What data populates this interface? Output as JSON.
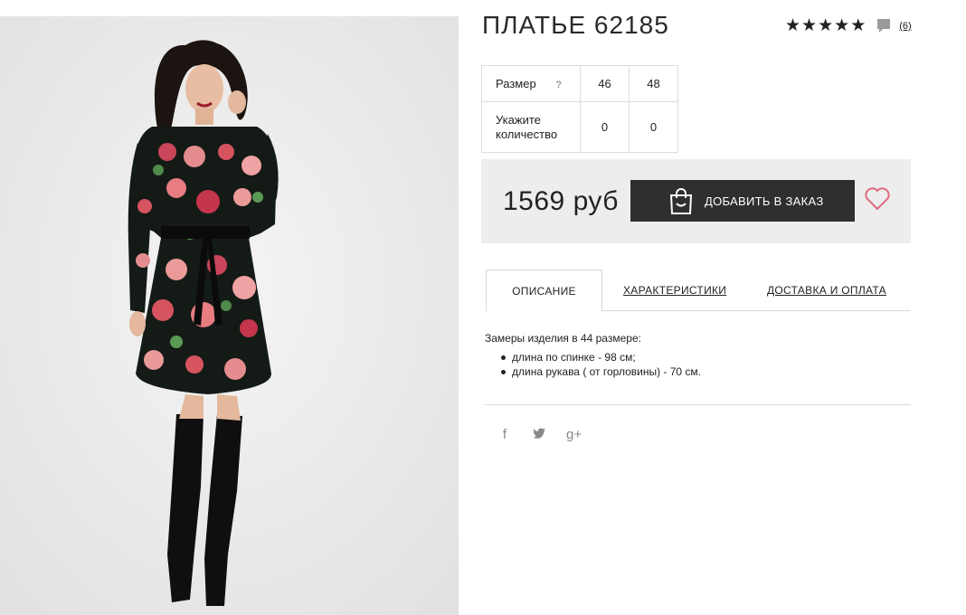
{
  "product": {
    "title": "ПЛАТЬЕ 62185",
    "rating_stars": 5,
    "reviews_count": "(6)",
    "photo_icon": "product-photo"
  },
  "sizes": {
    "size_label": "Размер",
    "help": "?",
    "size_values": [
      "46",
      "48"
    ],
    "qty_label_line1": "Укажите",
    "qty_label_line2": "количество",
    "qty_values": [
      "0",
      "0"
    ]
  },
  "buy": {
    "price": "1569 руб",
    "button_label": "ДОБАВИТЬ В ЗАКАЗ",
    "button_icon": "shopping-bag-icon",
    "favorite_icon": "heart-icon"
  },
  "tabs": [
    {
      "label": "ОПИСАНИЕ",
      "active": true
    },
    {
      "label": "ХАРАКТЕРИСТИКИ",
      "active": false
    },
    {
      "label": "ДОСТАВКА И ОПЛАТА",
      "active": false
    }
  ],
  "description": {
    "intro": "Замеры изделия в 44 размере:",
    "items": [
      "длина по спинке - 98 см;",
      "длина рукава ( от горловины) - 70 см."
    ]
  },
  "social": {
    "facebook": "f",
    "twitter": "🐦",
    "googleplus": "g+"
  },
  "colors": {
    "button_bg": "#2f2f2f",
    "buybox_bg": "#ededed",
    "heart": "#e06b80"
  }
}
